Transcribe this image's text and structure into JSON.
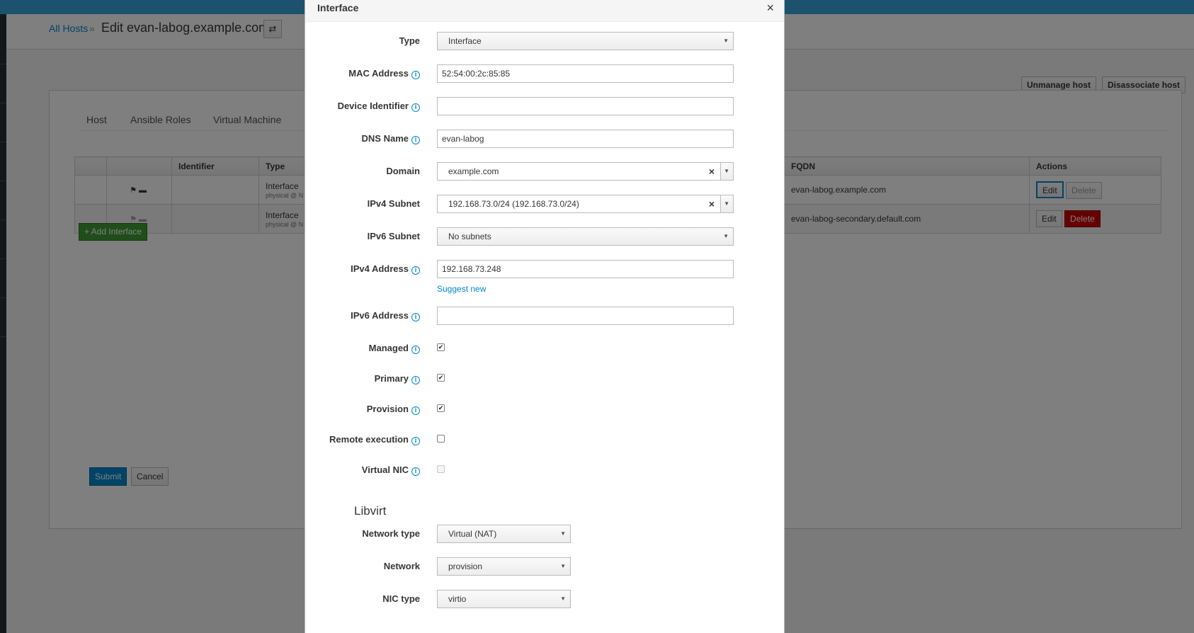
{
  "header": {
    "breadcrumb_link": "All Hosts",
    "breadcrumb_sep": "»",
    "title": "Edit evan-labog.example.com",
    "switch_icon": "⇄"
  },
  "actions": {
    "unmanage": "Unmanage host",
    "disassociate": "Disassociate host"
  },
  "tabs": [
    "Host",
    "Ansible Roles",
    "Virtual Machine"
  ],
  "table": {
    "headers": [
      "",
      "",
      "Identifier",
      "Type",
      "FQDN",
      "Actions"
    ],
    "rows": [
      {
        "type": "Interface",
        "sub": "physical @ N",
        "fqdn": "evan-labog.example.com",
        "edit": "Edit",
        "delete": "Delete"
      },
      {
        "type": "Interface",
        "sub": "physical @ N",
        "fqdn": "evan-labog-secondary.default.com",
        "edit": "Edit",
        "delete": "Delete"
      }
    ]
  },
  "add_interface": "+ Add Interface",
  "submit": "Submit",
  "cancel": "Cancel",
  "modal": {
    "title": "Interface",
    "close": "×",
    "fields": {
      "type": {
        "label": "Type",
        "value": "Interface"
      },
      "mac": {
        "label": "MAC Address",
        "value": "52:54:00:2c:85:85"
      },
      "device": {
        "label": "Device Identifier",
        "value": ""
      },
      "dns": {
        "label": "DNS Name",
        "value": "evan-labog"
      },
      "domain": {
        "label": "Domain",
        "value": "example.com"
      },
      "ipv4_subnet": {
        "label": "IPv4 Subnet",
        "value": "192.168.73.0/24 (192.168.73.0/24)"
      },
      "ipv6_subnet": {
        "label": "IPv6 Subnet",
        "value": "No subnets"
      },
      "ipv4": {
        "label": "IPv4 Address",
        "value": "192.168.73.248"
      },
      "suggest": "Suggest new",
      "ipv6": {
        "label": "IPv6 Address",
        "value": ""
      },
      "managed": {
        "label": "Managed",
        "checked": true
      },
      "primary": {
        "label": "Primary",
        "checked": true
      },
      "provision": {
        "label": "Provision",
        "checked": true
      },
      "remote": {
        "label": "Remote execution",
        "checked": false
      },
      "virtual": {
        "label": "Virtual NIC",
        "checked": false
      }
    },
    "libvirt": {
      "heading": "Libvirt",
      "network_type": {
        "label": "Network type",
        "value": "Virtual (NAT)"
      },
      "network": {
        "label": "Network",
        "value": "provision"
      },
      "nic_type": {
        "label": "NIC type",
        "value": "virtio"
      }
    }
  },
  "colors": {
    "accent": "#0088ce",
    "success": "#3f9c35",
    "danger": "#cc0000"
  }
}
